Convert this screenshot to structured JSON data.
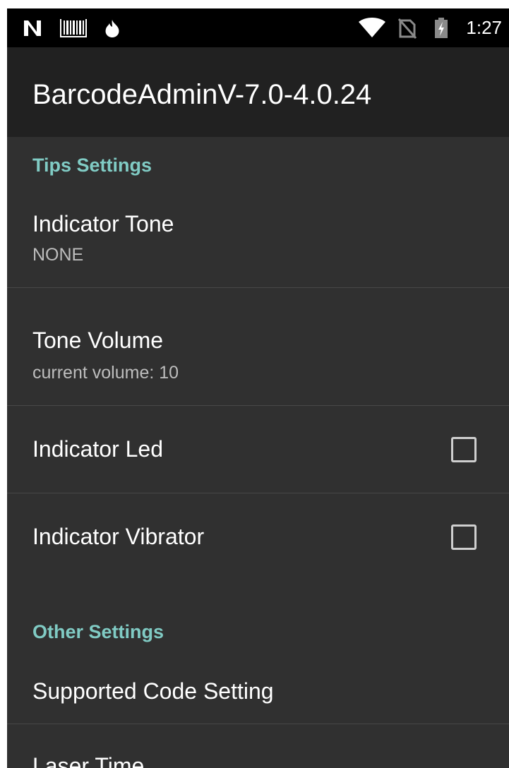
{
  "status_bar": {
    "time": "1:27",
    "left_icons": [
      "n-notification-icon",
      "barcode-icon",
      "flame-icon"
    ],
    "right_icons": [
      "wifi-icon",
      "no-sim-icon",
      "battery-charging-icon"
    ]
  },
  "app_bar": {
    "title": "BarcodeAdminV-7.0-4.0.24"
  },
  "colors": {
    "category_accent": "#80cbc4",
    "background": "#303030",
    "app_bar": "#212121",
    "status_bar": "#000000"
  },
  "sections": [
    {
      "header": "Tips Settings",
      "items": [
        {
          "title": "Indicator Tone",
          "summary": "NONE"
        },
        {
          "title": "Tone Volume",
          "summary": "current volume: 10"
        },
        {
          "title": "Indicator Led",
          "checked": false
        },
        {
          "title": "Indicator Vibrator",
          "checked": false
        }
      ]
    },
    {
      "header": "Other Settings",
      "items": [
        {
          "title": "Supported Code Setting"
        },
        {
          "title": "Laser Time"
        }
      ]
    }
  ]
}
